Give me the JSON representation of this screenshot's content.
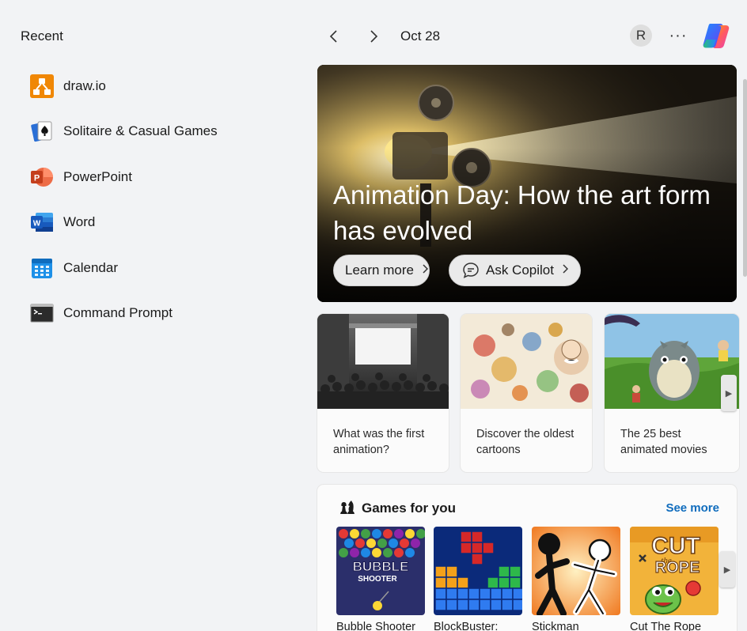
{
  "recent": {
    "title": "Recent",
    "items": [
      {
        "label": "draw.io",
        "icon": "drawio-icon"
      },
      {
        "label": "Solitaire & Casual Games",
        "icon": "solitaire-icon"
      },
      {
        "label": "PowerPoint",
        "icon": "powerpoint-icon"
      },
      {
        "label": "Word",
        "icon": "word-icon"
      },
      {
        "label": "Calendar",
        "icon": "calendar-icon"
      },
      {
        "label": "Command Prompt",
        "icon": "command-prompt-icon"
      }
    ]
  },
  "header": {
    "date": "Oct 28",
    "avatar_initial": "R",
    "more_label": "···"
  },
  "hero": {
    "title": "Animation Day: How the art form has evolved",
    "learn_more": "Learn more",
    "ask_copilot": "Ask Copilot"
  },
  "cards": [
    {
      "caption": "What was the first animation?"
    },
    {
      "caption": "Discover the oldest cartoons"
    },
    {
      "caption": "The 25 best animated movies"
    }
  ],
  "games": {
    "title": "Games for you",
    "see_more": "See more",
    "items": [
      {
        "name": "Bubble Shooter",
        "tile_text": "BUBBLE",
        "tile_sub": "SHOOTER"
      },
      {
        "name": "BlockBuster:"
      },
      {
        "name": "Stickman"
      },
      {
        "name": "Cut The Rope",
        "tile_text": "CUT",
        "tile_sub": "ROPE",
        "tile_the": "the"
      }
    ]
  },
  "colors": {
    "accent": "#0f6cbd",
    "background": "#f2f3f5",
    "card": "#fbfbfb"
  }
}
